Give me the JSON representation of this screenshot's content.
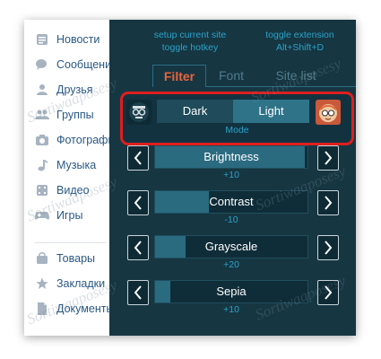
{
  "vk_nav": {
    "items": [
      {
        "icon": "newspaper-icon",
        "label": "Новости"
      },
      {
        "icon": "chat-bubbles-icon",
        "label": "Сообщения"
      },
      {
        "icon": "person-icon",
        "label": "Друзья"
      },
      {
        "icon": "group-icon",
        "label": "Группы"
      },
      {
        "icon": "camera-icon",
        "label": "Фотографии"
      },
      {
        "icon": "music-note-icon",
        "label": "Музыка"
      },
      {
        "icon": "film-icon",
        "label": "Видео"
      },
      {
        "icon": "gamepad-icon",
        "label": "Игры"
      },
      {
        "icon": "shopping-bag-icon",
        "label": "Товары"
      },
      {
        "icon": "star-icon",
        "label": "Закладки"
      },
      {
        "icon": "document-icon",
        "label": "Документы"
      }
    ]
  },
  "extension": {
    "links": {
      "setup_site": "setup current site",
      "toggle_hotkey": "toggle hotkey",
      "toggle_extension": "toggle extension",
      "hotkey": "Alt+Shift+D"
    },
    "tabs": [
      "Filter",
      "Font",
      "Site list"
    ],
    "active_tab": "Filter",
    "mode": {
      "options": [
        "Dark",
        "Light"
      ],
      "selected": "Light",
      "label": "Mode",
      "left_icon": "dark-mode-avatar-icon",
      "right_icon": "light-mode-avatar-icon"
    },
    "controls": [
      {
        "label": "Brightness",
        "value": "+10",
        "fill": 0.98
      },
      {
        "label": "Contrast",
        "value": "-10",
        "fill": 0.35
      },
      {
        "label": "Grayscale",
        "value": "+20",
        "fill": 0.2
      },
      {
        "label": "Sepia",
        "value": "+10",
        "fill": 0.1
      }
    ]
  },
  "watermark": "Sortiwaaposesy",
  "colors": {
    "panel_bg": "#163642",
    "accent_link": "#2aa3c9",
    "active_tab": "#e8643c",
    "highlight_border": "#dd1f1f",
    "slider_fill": "#2a6b80"
  }
}
